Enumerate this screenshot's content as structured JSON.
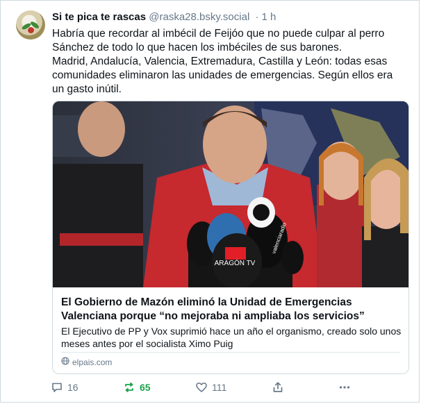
{
  "post": {
    "author_name": "Si te pica te rascas",
    "author_handle": "@raska28.bsky.social",
    "separator": "·",
    "time_ago": "1 h",
    "text_lines": [
      "Habría que recordar al imbécil de Feijóo que no puede culpar al perro Sánchez de todo lo que hacen los imbéciles de sus barones.",
      "Madrid, Andalucía, Valencia, Extremadura, Castilla y León: todas esas comunidades eliminaron las unidades de emergencias. Según ellos era un gasto inútil."
    ]
  },
  "link_card": {
    "image_subject": "news-conference-photo",
    "image_texts": {
      "mic_logo_1": "ARAGÓN TV",
      "mic_logo_2": "valenciaradio"
    },
    "title": "El Gobierno de Mazón eliminó la Unidad de Emergencias Valenciana porque “no mejoraba ni ampliaba los servicios”",
    "description": "El Ejecutivo de PP y Vox suprimió hace un año el organismo, creado solo unos meses antes por el socialista Ximo Puig",
    "domain": "elpais.com"
  },
  "actions": {
    "replies": "16",
    "reposts": "65",
    "likes": "111"
  },
  "colors": {
    "repost_active": "#16a34a",
    "muted": "#66788a",
    "border": "#cfd9de"
  }
}
